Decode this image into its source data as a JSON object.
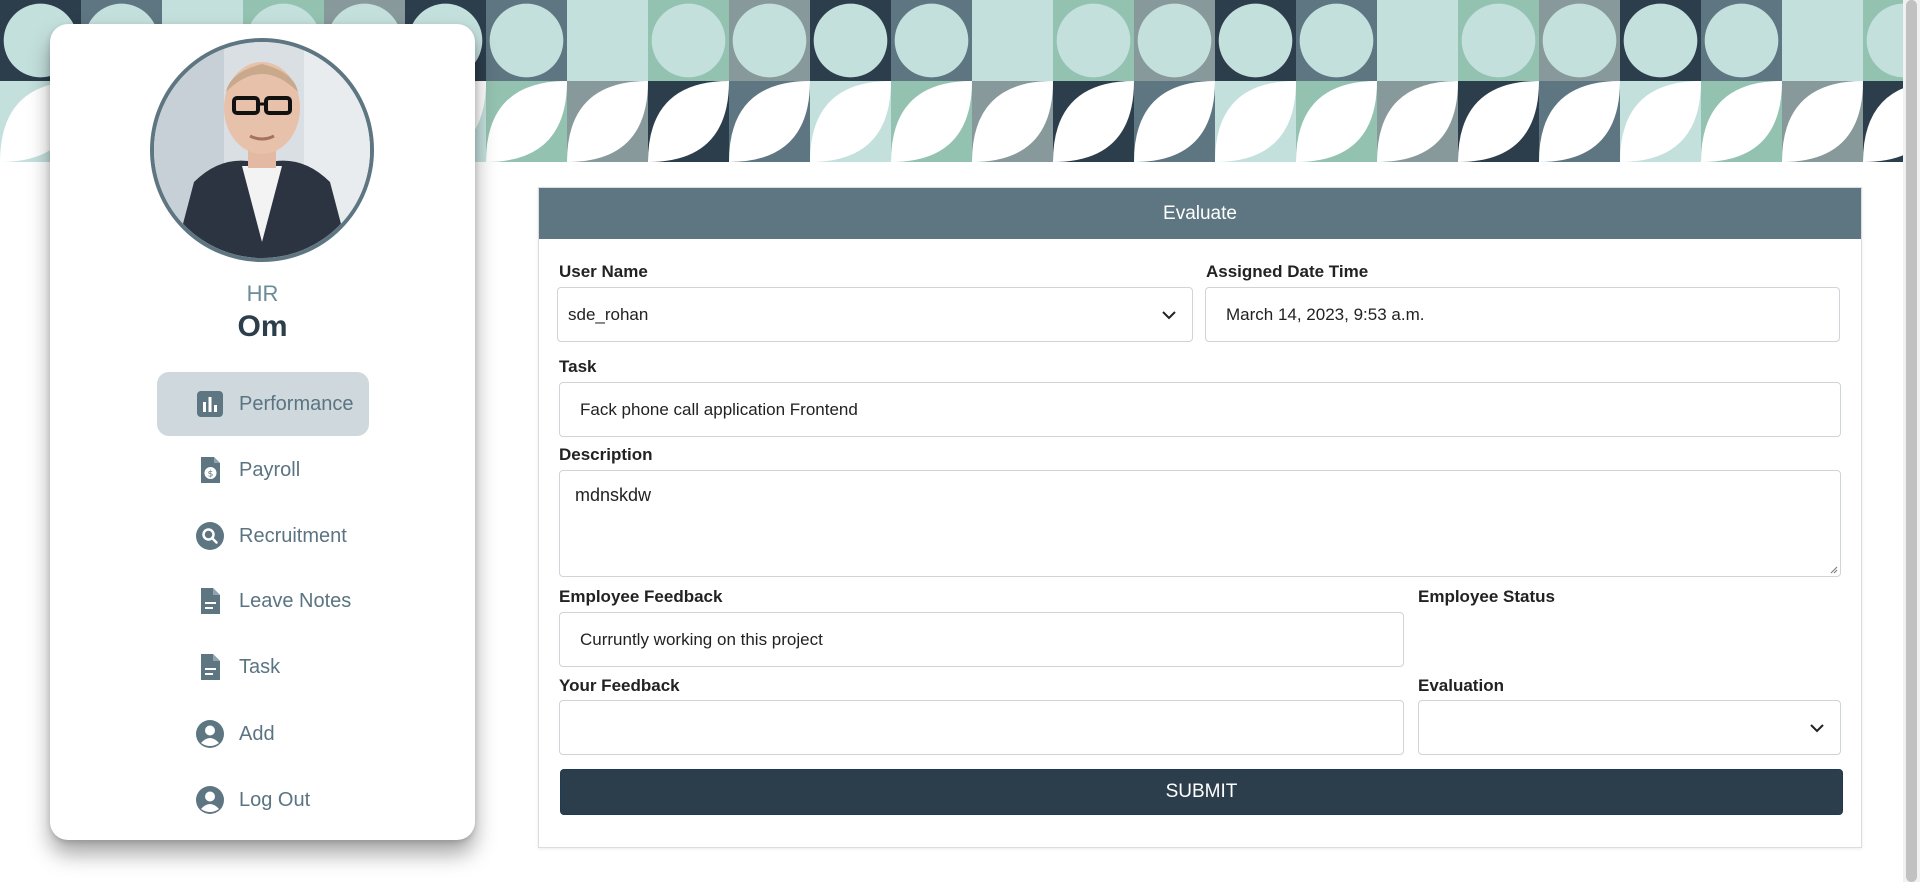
{
  "sidebar": {
    "role": "HR",
    "user_name": "Om",
    "items": [
      {
        "label": "Performance",
        "icon": "chart-icon",
        "active": true
      },
      {
        "label": "Payroll",
        "icon": "payroll-document-icon",
        "active": false
      },
      {
        "label": "Recruitment",
        "icon": "search-icon",
        "active": false
      },
      {
        "label": "Leave Notes",
        "icon": "document-icon",
        "active": false
      },
      {
        "label": "Task",
        "icon": "document-icon",
        "active": false
      },
      {
        "label": "Add",
        "icon": "user-circle-icon",
        "active": false
      },
      {
        "label": "Log Out",
        "icon": "user-circle-icon",
        "active": false
      }
    ]
  },
  "form": {
    "title": "Evaluate",
    "user_name_label": "User Name",
    "user_name_value": "sde_rohan",
    "assigned_label": "Assigned Date Time",
    "assigned_value": "March 14, 2023, 9:53 a.m.",
    "task_label": "Task",
    "task_value": "Fack phone call application Frontend",
    "description_label": "Description",
    "description_value": "mdnskdw",
    "employee_feedback_label": "Employee Feedback",
    "employee_feedback_value": "Curruntly working on this project",
    "employee_status_label": "Employee Status",
    "employee_status_value": "",
    "your_feedback_label": "Your Feedback",
    "your_feedback_value": "",
    "evaluation_label": "Evaluation",
    "evaluation_value": "",
    "submit_label": "SUBMIT"
  },
  "colors": {
    "accent": "#5e7682",
    "dark": "#2c3e4c",
    "banner_mint": "#c4e0dd",
    "banner_sage": "#94c2b0",
    "banner_dot": "#f07a6a"
  }
}
